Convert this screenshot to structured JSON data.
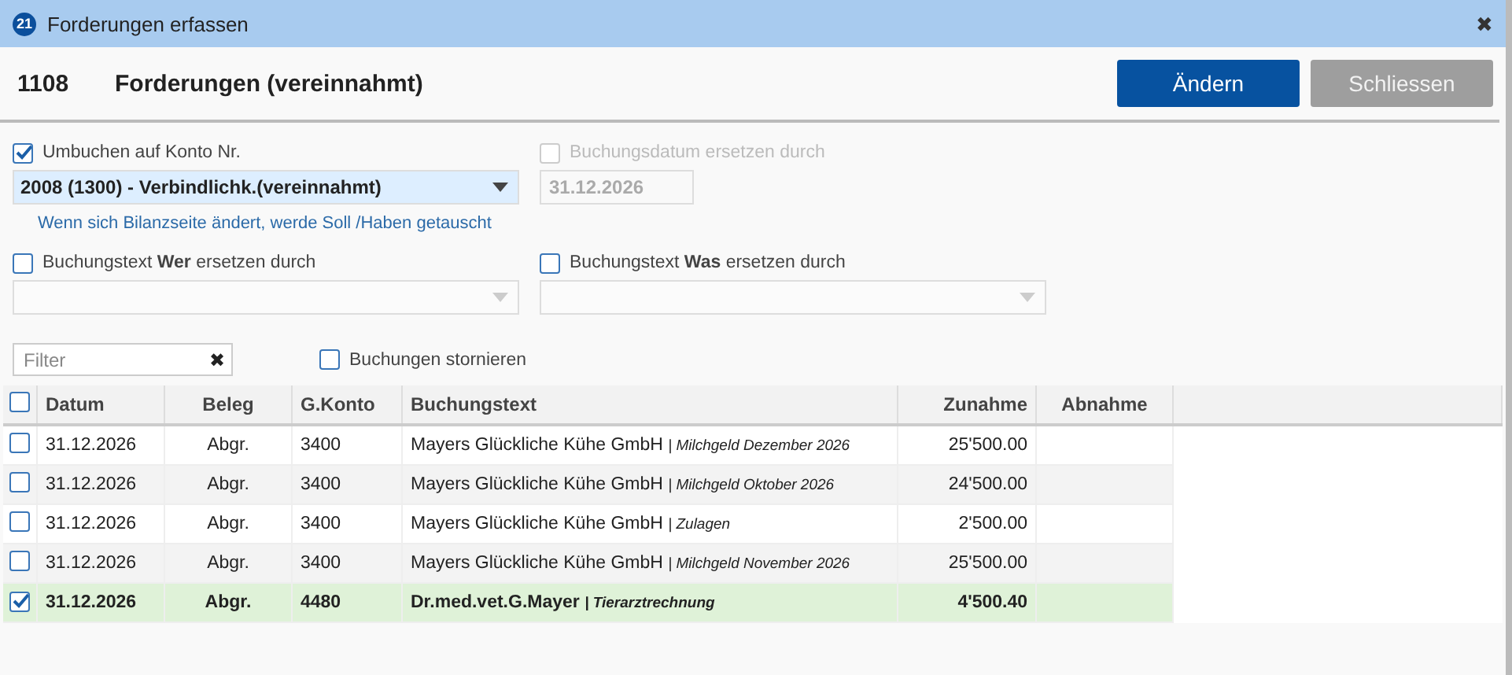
{
  "window": {
    "badge": "21",
    "title": "Forderungen erfassen",
    "close": "✖"
  },
  "header": {
    "account": "1108",
    "name": "Forderungen (vereinnahmt)"
  },
  "buttons": [
    {
      "label": "Ändern",
      "kind": "primary"
    },
    {
      "label": "Schliessen",
      "kind": "secondary"
    }
  ],
  "rebook": {
    "label": "Umbuchen auf Konto Nr.",
    "checked": true,
    "value": "2008 (1300) - Verbindlichk.(vereinnahmt)",
    "hint": "Wenn sich Bilanzseite ändert, werde Soll /Haben getauscht"
  },
  "date_replace": {
    "label": "Buchungsdatum ersetzen durch",
    "checked": false,
    "disabled": true,
    "value": "31.12.2026"
  },
  "text_who": {
    "label": "Buchungstext **Wer** ersetzen durch",
    "checked": false
  },
  "text_what": {
    "label": "Buchungstext **Was** ersetzen durch",
    "checked": false
  },
  "filter": {
    "placeholder": "Filter",
    "clear": "✖"
  },
  "cancel_bookings": {
    "label": "Buchungen stornieren",
    "checked": false
  },
  "table": {
    "select_all": false,
    "columns": [
      "Datum",
      "Beleg",
      "G.Konto",
      "Buchungstext",
      "Zunahme",
      "Abnahme"
    ],
    "rows": [
      {
        "checked": false,
        "date": "31.12.2026",
        "voucher": "Abgr.",
        "account": "3400",
        "text": "Mayers Glückliche Kühe GmbH *| Milchgeld Dezember 2026*",
        "increase": "25'500.00"
      },
      {
        "checked": false,
        "date": "31.12.2026",
        "voucher": "Abgr.",
        "account": "3400",
        "text": "Mayers Glückliche Kühe GmbH *| Milchgeld Oktober 2026*",
        "increase": "24'500.00"
      },
      {
        "checked": false,
        "date": "31.12.2026",
        "voucher": "Abgr.",
        "account": "3400",
        "text": "Mayers Glückliche Kühe GmbH *| Zulagen*",
        "increase": "2'500.00"
      },
      {
        "checked": false,
        "date": "31.12.2026",
        "voucher": "Abgr.",
        "account": "3400",
        "text": "Mayers Glückliche Kühe GmbH *| Milchgeld November 2026*",
        "increase": "25'500.00"
      },
      {
        "checked": true,
        "date": "31.12.2026",
        "voucher": "Abgr.",
        "account": "4480",
        "text": "Dr.med.vet.G.Mayer *| Tierarztrechnung*",
        "increase": "4'500.40"
      }
    ]
  }
}
